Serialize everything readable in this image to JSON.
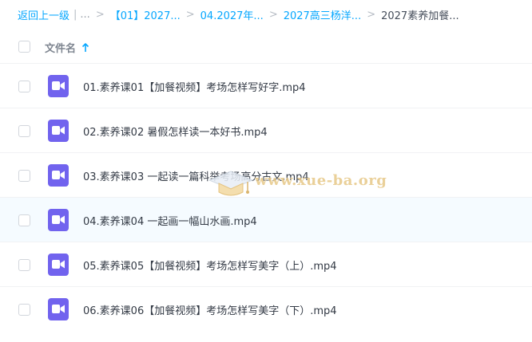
{
  "breadcrumb": {
    "back_label": "返回上一级",
    "separator_bar": "|",
    "ellipsis": "...",
    "separator": ">",
    "items": [
      {
        "label": "【01】2027..."
      },
      {
        "label": "04.2027年..."
      },
      {
        "label": "2027高三杨洋..."
      }
    ],
    "current": "2027素养加餐..."
  },
  "list_header": {
    "column_title": "文件名",
    "sort_direction": "ascending"
  },
  "files": [
    {
      "name": "01.素养课01【加餐视频】考场怎样写好字.mp4",
      "icon": "video-file-icon"
    },
    {
      "name": "02.素养课02 暑假怎样读一本好书.mp4",
      "icon": "video-file-icon"
    },
    {
      "name": "03.素养课03 一起读一篇科举考场高分古文.mp4",
      "icon": "video-file-icon"
    },
    {
      "name": "04.素养课04 一起画一幅山水画.mp4",
      "icon": "video-file-icon"
    },
    {
      "name": "05.素养课05【加餐视频】考场怎样写美字（上）.mp4",
      "icon": "video-file-icon"
    },
    {
      "name": "06.素养课06【加餐视频】考场怎样写美字（下）.mp4",
      "icon": "video-file-icon"
    }
  ],
  "watermark": {
    "text": "www.xue-ba.org"
  },
  "colors": {
    "accent": "#06a7ff",
    "video_icon": "#7163ee",
    "hover_row": "#f5fbff"
  }
}
